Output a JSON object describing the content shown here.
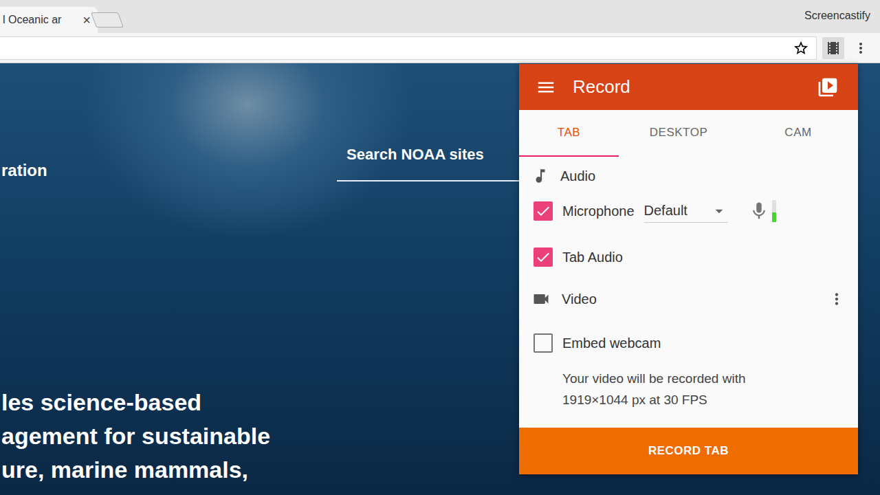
{
  "browser": {
    "tab": {
      "title": "l Oceanic ar",
      "close": "×",
      "selected": true
    },
    "profile": "Screencastify"
  },
  "page": {
    "heading": "ration",
    "search": {
      "placeholder": "Search NOAA sites"
    },
    "lines": [
      "les science-based",
      "agement for sustainable",
      "ure, marine mammals,"
    ]
  },
  "popup": {
    "title": "Record",
    "tabs": [
      {
        "label": "TAB",
        "selected": true
      },
      {
        "label": "DESKTOP",
        "selected": false
      },
      {
        "label": "CAM",
        "selected": false
      }
    ],
    "sections": [
      {
        "kind": "audio",
        "label": "Audio",
        "options": [
          {
            "kind": "device",
            "label": "Microphone",
            "checked": true,
            "device": "Default",
            "level": 0.45
          },
          {
            "kind": "toggle",
            "label": "Tab Audio",
            "checked": true
          }
        ]
      },
      {
        "kind": "video",
        "label": "Video",
        "options": [
          {
            "kind": "toggle",
            "label": "Embed webcam",
            "checked": false
          }
        ],
        "info": [
          "Your video will be recorded with",
          "1919×1044 px at 30 FPS"
        ]
      }
    ],
    "button": "RECORD TAB"
  }
}
